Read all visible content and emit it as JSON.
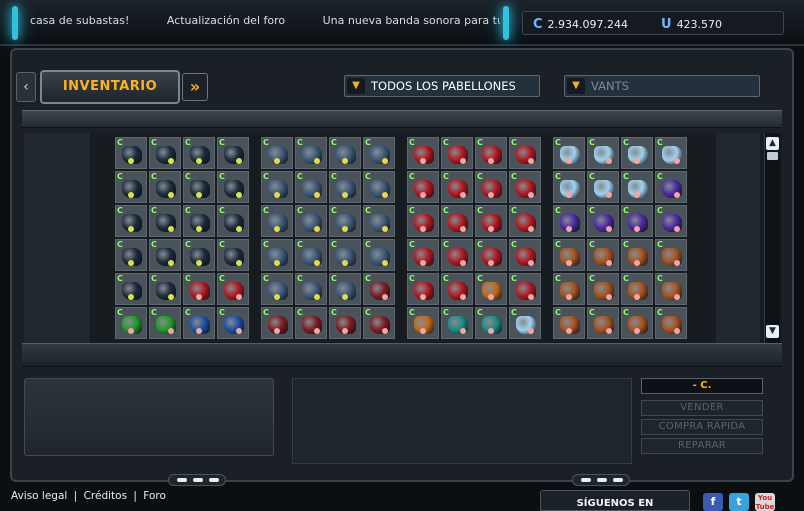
{
  "ticker": [
    "casa de subastas!",
    "Actualización del foro",
    "Una nueva banda sonora para tus"
  ],
  "currency": {
    "credits_icon": "credits-icon",
    "credits": "2.934.097.244",
    "uridium_icon": "uridium-icon",
    "uridium": "423.570"
  },
  "tabs": {
    "prev_icon": "‹",
    "inventory_label": "INVENTARIO",
    "next_icon": "»"
  },
  "filters": {
    "hangar_label": "TODOS LOS PABELLONES",
    "ship_placeholder": "VANTS",
    "dropdown_icon": "▼"
  },
  "inventory": {
    "slot_badge": "C",
    "groups": [
      {
        "name": "lasers",
        "cells": [
          "dark",
          "dark",
          "dark",
          "dark",
          "dark",
          "dark",
          "dark",
          "dark",
          "dark",
          "dark",
          "dark",
          "dark",
          "dark",
          "dark",
          "dark",
          "dark",
          "dark",
          "dark",
          "red",
          "red",
          "green",
          "green",
          "blue",
          "blue"
        ]
      },
      {
        "name": "generators",
        "cells": [
          "steel",
          "steel",
          "steel",
          "steel",
          "steel",
          "steel",
          "steel",
          "steel",
          "steel",
          "steel",
          "steel",
          "steel",
          "steel",
          "steel",
          "steel",
          "steel",
          "steel",
          "steel",
          "steel",
          "redjet",
          "redjet",
          "redjet",
          "redjet",
          "redjet"
        ]
      },
      {
        "name": "drones",
        "cells": [
          "red",
          "red",
          "red",
          "red",
          "red",
          "red",
          "red",
          "red",
          "red",
          "red",
          "red",
          "red",
          "red",
          "red",
          "red",
          "red",
          "red",
          "red",
          "orange",
          "red",
          "orange",
          "teal",
          "teal",
          "ice"
        ]
      },
      {
        "name": "extras",
        "cells": [
          "ice",
          "ice",
          "ice",
          "ice",
          "ice",
          "ice",
          "ice",
          "plasma",
          "plasma",
          "plasma",
          "plasma",
          "plasma",
          "copper",
          "copper",
          "copper",
          "copper",
          "copper",
          "copper",
          "copper",
          "copper",
          "copper",
          "copper",
          "copper",
          "copper"
        ]
      }
    ],
    "colors": {
      "dark": "#1c2a3c",
      "red": "#b01820",
      "green": "#1f9a2a",
      "blue": "#1d4fa8",
      "steel": "#3c5878",
      "redjet": "#7a1d22",
      "orange": "#c06a1a",
      "teal": "#1d8a86",
      "ice": "#9fd2ee",
      "plasma": "#4a2a9e",
      "copper": "#a5521f"
    }
  },
  "scroll": {
    "up_icon": "▲",
    "down_icon": "▼"
  },
  "actions": {
    "price": "- C.",
    "sell": "VENDER",
    "quick_buy": "COMPRA RÁPIDA",
    "repair": "REPARAR"
  },
  "footer": {
    "legal": "Aviso legal",
    "sep1": "|",
    "credits": "Créditos",
    "sep2": "|",
    "forum": "Foro",
    "follow": "SÍGUENOS EN",
    "facebook": "f",
    "twitter": "t",
    "youtube": "You Tube"
  }
}
